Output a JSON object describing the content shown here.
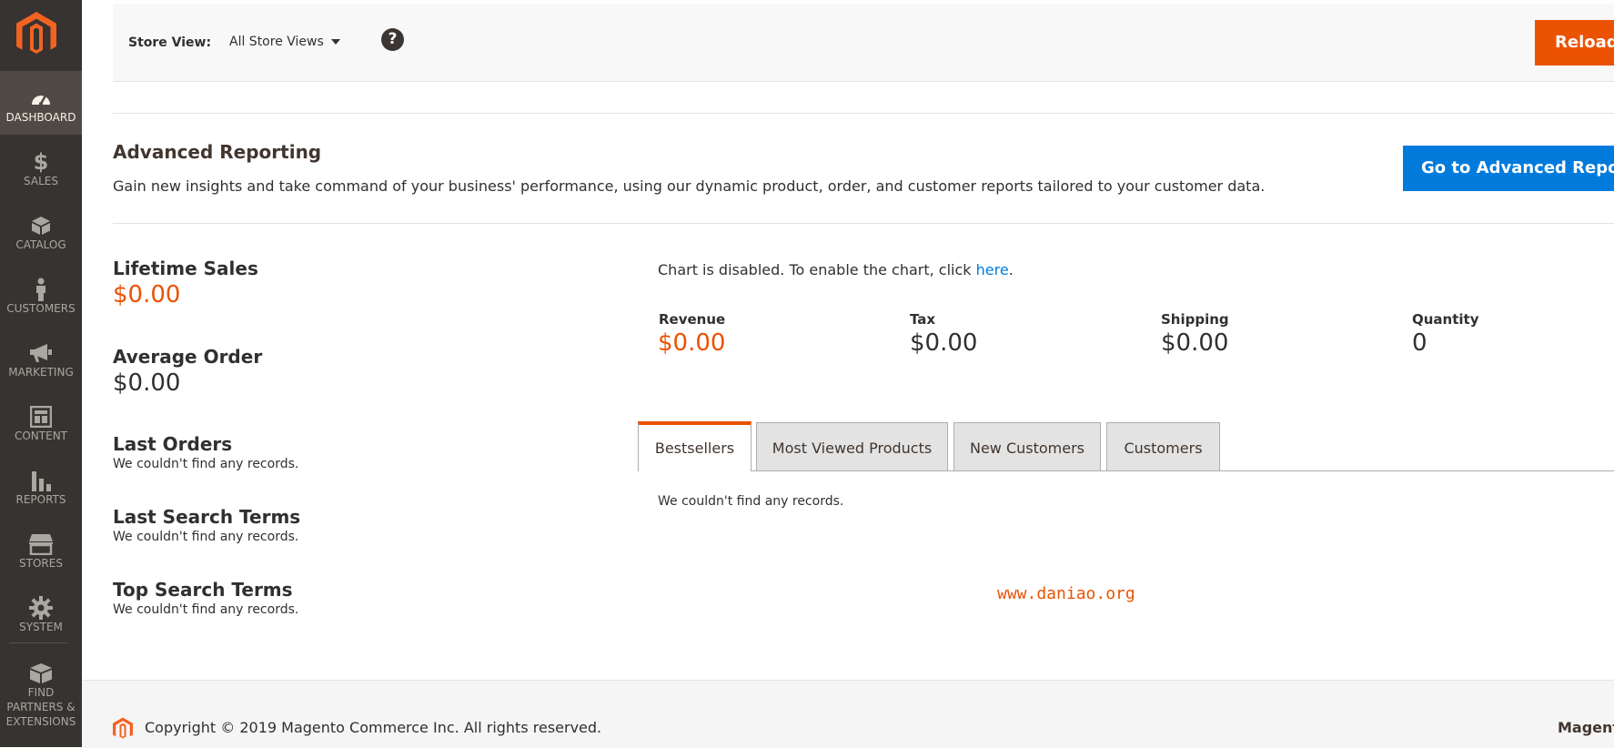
{
  "sidebar": {
    "items": [
      {
        "label": "DASHBOARD",
        "icon": "dashboard-icon"
      },
      {
        "label": "SALES",
        "icon": "dollar-icon"
      },
      {
        "label": "CATALOG",
        "icon": "box-icon"
      },
      {
        "label": "CUSTOMERS",
        "icon": "person-icon"
      },
      {
        "label": "MARKETING",
        "icon": "megaphone-icon"
      },
      {
        "label": "CONTENT",
        "icon": "layout-icon"
      },
      {
        "label": "REPORTS",
        "icon": "bar-chart-icon"
      },
      {
        "label": "STORES",
        "icon": "storefront-icon"
      },
      {
        "label": "SYSTEM",
        "icon": "gear-icon"
      }
    ],
    "find": {
      "line1": "FIND",
      "line2": "PARTNERS &",
      "line3": "EXTENSIONS"
    }
  },
  "header": {
    "store_view_label": "Store View:",
    "store_view_value": "All Store Views",
    "help": "?",
    "reload": "Reload"
  },
  "advanced": {
    "title": "Advanced Reporting",
    "description": "Gain new insights and take command of your business' performance, using our dynamic product, order, and customer reports tailored to your customer data.",
    "button": "Go to Advanced Reporting"
  },
  "stats": {
    "lifetime_label": "Lifetime Sales",
    "lifetime_value": "$0.00",
    "average_label": "Average Order",
    "average_value": "$0.00"
  },
  "sections": {
    "last_orders": {
      "title": "Last Orders",
      "note": "We couldn't find any records."
    },
    "last_search": {
      "title": "Last Search Terms",
      "note": "We couldn't find any records."
    },
    "top_search": {
      "title": "Top Search Terms",
      "note": "We couldn't find any records."
    }
  },
  "chart": {
    "msg": "Chart is disabled. To enable the chart, click ",
    "link": "here",
    "after": "."
  },
  "totals": [
    {
      "label": "Revenue",
      "value": "$0.00"
    },
    {
      "label": "Tax",
      "value": "$0.00"
    },
    {
      "label": "Shipping",
      "value": "$0.00"
    },
    {
      "label": "Quantity",
      "value": "0"
    }
  ],
  "tabs": [
    {
      "label": "Bestsellers"
    },
    {
      "label": "Most Viewed Products"
    },
    {
      "label": "New Customers"
    },
    {
      "label": "Customers"
    }
  ],
  "tab_content": "We couldn't find any records.",
  "watermark": "www.daniao.org",
  "footer": {
    "copyright": "Copyright © 2019 Magento Commerce Inc. All rights reserved.",
    "right": "Magento"
  },
  "colors": {
    "accent": "#eb5202",
    "link": "#007bdb",
    "sidebar": "#373330"
  }
}
